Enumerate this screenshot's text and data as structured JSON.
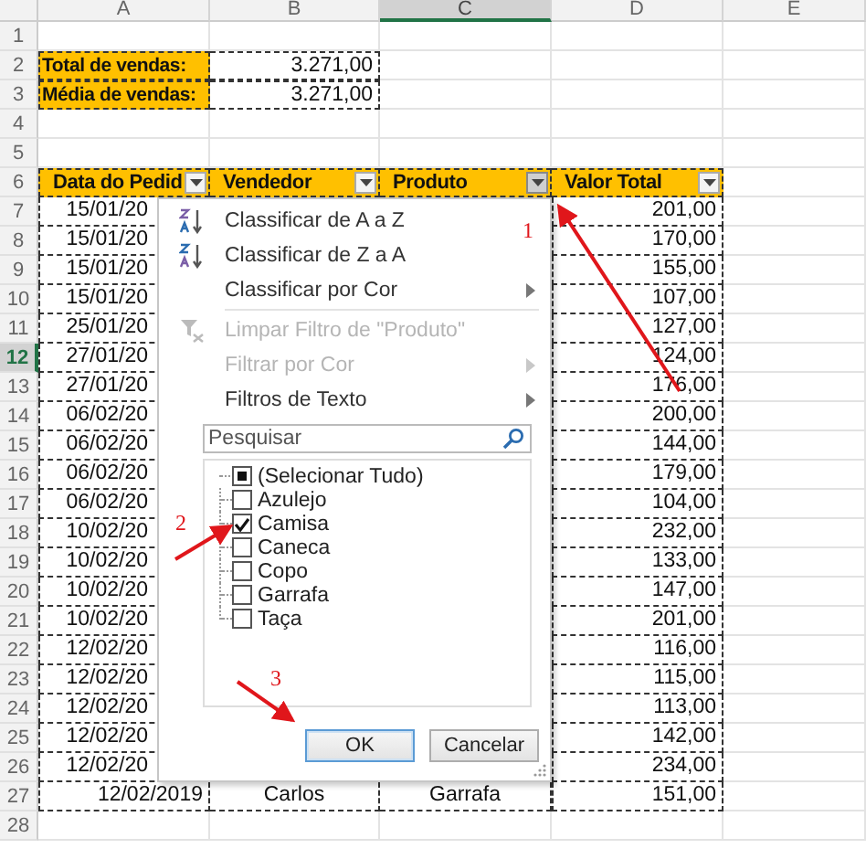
{
  "column_headers": [
    {
      "label": "A",
      "selected": false
    },
    {
      "label": "B",
      "selected": false
    },
    {
      "label": "C",
      "selected": true
    },
    {
      "label": "D",
      "selected": false
    },
    {
      "label": "E",
      "selected": false
    }
  ],
  "row_headers": [
    {
      "label": "1",
      "selected": false
    },
    {
      "label": "2",
      "selected": false
    },
    {
      "label": "3",
      "selected": false
    },
    {
      "label": "4",
      "selected": false
    },
    {
      "label": "5",
      "selected": false
    },
    {
      "label": "6",
      "selected": false
    },
    {
      "label": "7",
      "selected": false
    },
    {
      "label": "8",
      "selected": false
    },
    {
      "label": "9",
      "selected": false
    },
    {
      "label": "10",
      "selected": false
    },
    {
      "label": "11",
      "selected": false
    },
    {
      "label": "12",
      "selected": true
    },
    {
      "label": "13",
      "selected": false
    },
    {
      "label": "14",
      "selected": false
    },
    {
      "label": "15",
      "selected": false
    },
    {
      "label": "16",
      "selected": false
    },
    {
      "label": "17",
      "selected": false
    },
    {
      "label": "18",
      "selected": false
    },
    {
      "label": "19",
      "selected": false
    },
    {
      "label": "20",
      "selected": false
    },
    {
      "label": "21",
      "selected": false
    },
    {
      "label": "22",
      "selected": false
    },
    {
      "label": "23",
      "selected": false
    },
    {
      "label": "24",
      "selected": false
    },
    {
      "label": "25",
      "selected": false
    },
    {
      "label": "26",
      "selected": false
    },
    {
      "label": "27",
      "selected": false
    },
    {
      "label": "28",
      "selected": false
    }
  ],
  "summary": [
    {
      "label": "Total de vendas:",
      "value": "3.271,00"
    },
    {
      "label": "Média de vendas:",
      "value": "3.271,00"
    }
  ],
  "table": {
    "columns": [
      {
        "label": "Data do Pedid",
        "filter_open": false
      },
      {
        "label": "Vendedor",
        "filter_open": false
      },
      {
        "label": "Produto",
        "filter_open": true
      },
      {
        "label": "Valor Total",
        "filter_open": false
      }
    ],
    "rows": [
      {
        "date": "15/01/20",
        "total": "201,00"
      },
      {
        "date": "15/01/20",
        "total": "170,00"
      },
      {
        "date": "15/01/20",
        "total": "155,00"
      },
      {
        "date": "15/01/20",
        "total": "107,00"
      },
      {
        "date": "25/01/20",
        "total": "127,00"
      },
      {
        "date": "27/01/20",
        "total": "124,00"
      },
      {
        "date": "27/01/20",
        "total": "176,00"
      },
      {
        "date": "06/02/20",
        "total": "200,00"
      },
      {
        "date": "06/02/20",
        "total": "144,00"
      },
      {
        "date": "06/02/20",
        "total": "179,00"
      },
      {
        "date": "06/02/20",
        "total": "104,00"
      },
      {
        "date": "10/02/20",
        "total": "232,00"
      },
      {
        "date": "10/02/20",
        "total": "133,00"
      },
      {
        "date": "10/02/20",
        "total": "147,00"
      },
      {
        "date": "10/02/20",
        "total": "201,00"
      },
      {
        "date": "12/02/20",
        "total": "116,00"
      },
      {
        "date": "12/02/20",
        "total": "115,00"
      },
      {
        "date": "12/02/20",
        "total": "113,00"
      },
      {
        "date": "12/02/20",
        "total": "142,00"
      },
      {
        "date": "12/02/20",
        "total": "234,00"
      },
      {
        "date": "12/02/2019",
        "seller": "Carlos",
        "product": "Garrafa",
        "total": "151,00"
      }
    ]
  },
  "filter_menu": {
    "groups": [
      [
        {
          "kind": "sort_ascending",
          "label": "Classificar de A a Z",
          "disabled": false,
          "submenu": false
        },
        {
          "kind": "sort_descending",
          "label": "Classificar de Z a A",
          "disabled": false,
          "submenu": false
        },
        {
          "kind": "plain",
          "label": "Classificar por Cor",
          "disabled": false,
          "submenu": true
        }
      ],
      [
        {
          "kind": "clear_filter",
          "label": "Limpar Filtro de \"Produto\"",
          "disabled": true,
          "submenu": false
        },
        {
          "kind": "plain",
          "label": "Filtrar por Cor",
          "disabled": true,
          "submenu": true
        },
        {
          "kind": "plain",
          "label": "Filtros de Texto",
          "disabled": false,
          "submenu": true
        }
      ]
    ],
    "search": {
      "placeholder": "Pesquisar"
    },
    "values": [
      {
        "kind": "select_all",
        "label": "(Selecionar Tudo)",
        "mixed": true
      },
      {
        "kind": "value",
        "label": "Azulejo",
        "checked": false
      },
      {
        "kind": "value",
        "label": "Camisa",
        "checked": true
      },
      {
        "kind": "value",
        "label": "Caneca",
        "checked": false
      },
      {
        "kind": "value",
        "label": "Copo",
        "checked": false
      },
      {
        "kind": "value",
        "label": "Garrafa",
        "checked": false
      },
      {
        "kind": "value",
        "label": "Taça",
        "checked": false
      }
    ],
    "buttons": [
      {
        "label": "OK",
        "default": true
      },
      {
        "label": "Cancelar",
        "default": false
      }
    ]
  },
  "annotations": [
    {
      "label": "1"
    },
    {
      "label": "2"
    },
    {
      "label": "3"
    }
  ]
}
